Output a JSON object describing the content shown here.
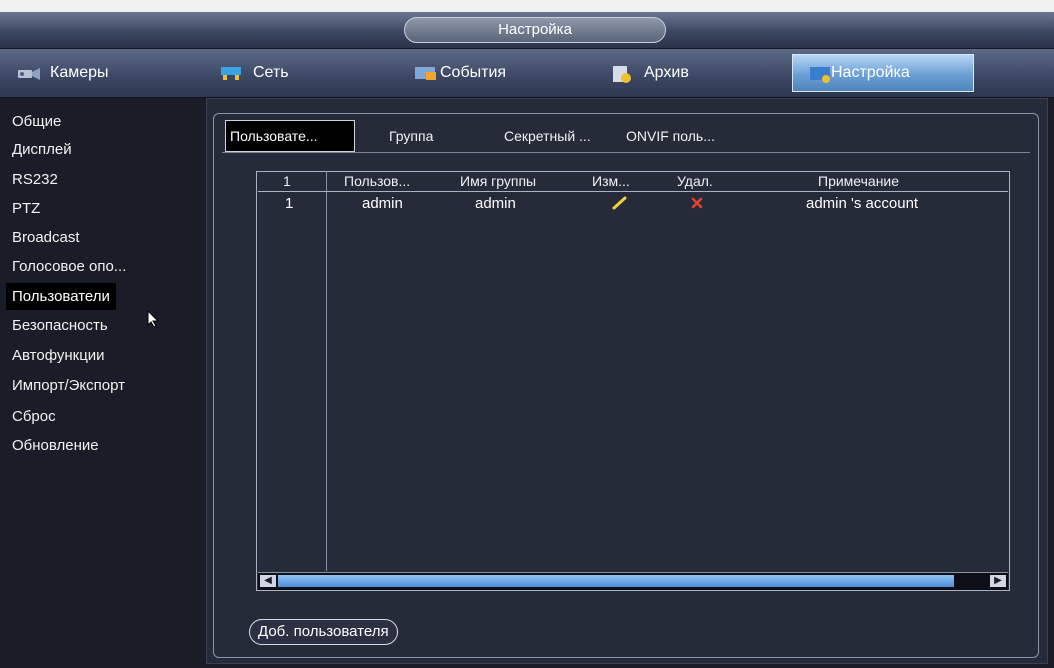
{
  "window": {
    "title": "Настройка"
  },
  "main_tabs": [
    {
      "label": "Камеры",
      "icon": "camera-icon"
    },
    {
      "label": "Сеть",
      "icon": "network-icon"
    },
    {
      "label": "События",
      "icon": "events-icon"
    },
    {
      "label": "Архив",
      "icon": "archive-icon"
    },
    {
      "label": "Настройка",
      "icon": "settings-icon",
      "active": true
    }
  ],
  "sidebar": {
    "items": [
      {
        "label": "Общие"
      },
      {
        "label": "Дисплей"
      },
      {
        "label": "RS232"
      },
      {
        "label": "PTZ"
      },
      {
        "label": "Broadcast"
      },
      {
        "label": "Голосовое опо..."
      },
      {
        "label": "Пользователи",
        "active": true
      },
      {
        "label": "Безопасность"
      },
      {
        "label": "Автофункции"
      },
      {
        "label": "Импорт/Экспорт"
      },
      {
        "label": "Сброс"
      },
      {
        "label": "Обновление"
      }
    ]
  },
  "sub_tabs": [
    {
      "label": "Пользовате...",
      "active": true
    },
    {
      "label": "Группа"
    },
    {
      "label": "Секретный ..."
    },
    {
      "label": "ONVIF поль..."
    }
  ],
  "table": {
    "headers": [
      "1",
      "Пользов...",
      "Имя группы",
      "Изм...",
      "Удал.",
      "Примечание"
    ],
    "rows": [
      {
        "index": "1",
        "user": "admin",
        "group": "admin",
        "edit_icon": "edit-icon",
        "delete_icon": "delete-icon",
        "note": "admin 's account"
      }
    ]
  },
  "actions": {
    "add_user": "Доб. пользователя"
  },
  "colors": {
    "accent": "#6b9fd4",
    "edit": "#f0d23c",
    "delete": "#e2452f"
  }
}
